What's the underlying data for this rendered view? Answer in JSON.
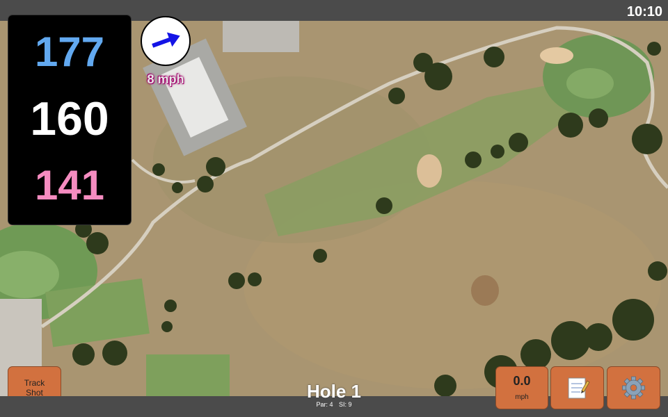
{
  "status": {
    "time": "10:10"
  },
  "distances": {
    "back": "177",
    "center": "160",
    "front": "141"
  },
  "wind": {
    "speed_label": "8 mph"
  },
  "buttons": {
    "track_line1": "Track",
    "track_line2": "Shot",
    "speed_value": "0.0",
    "speed_unit": "mph"
  },
  "hole": {
    "title": "Hole 1",
    "par": "Par: 4",
    "si": "SI: 9"
  },
  "icons": {
    "wind": "arrow-right-icon",
    "notes": "notepad-icon",
    "settings": "gear-icon"
  },
  "colors": {
    "back": "#62a9f0",
    "center": "#ffffff",
    "front": "#f58cc0",
    "button": "#d2713f",
    "bar": "#4b4b4b"
  }
}
